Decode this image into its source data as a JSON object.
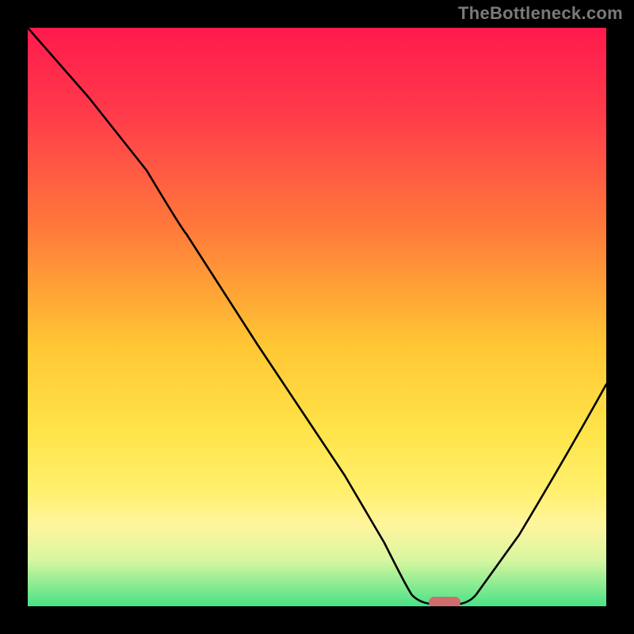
{
  "watermark": "TheBottleneck.com",
  "chart_data": {
    "type": "line",
    "title": "",
    "xlabel": "",
    "ylabel": "",
    "xlim": [
      0,
      100
    ],
    "ylim": [
      0,
      100
    ],
    "grid": false,
    "legend": false,
    "background_gradient": {
      "stops": [
        {
          "pos": 0,
          "color": "#ff1a4d"
        },
        {
          "pos": 15,
          "color": "#ff3b4a"
        },
        {
          "pos": 35,
          "color": "#ff7b3a"
        },
        {
          "pos": 55,
          "color": "#ffc733"
        },
        {
          "pos": 70,
          "color": "#ffe44a"
        },
        {
          "pos": 80,
          "color": "#fff06d"
        },
        {
          "pos": 86,
          "color": "#fff59e"
        },
        {
          "pos": 92,
          "color": "#d8f6a0"
        },
        {
          "pos": 100,
          "color": "#49e286"
        }
      ]
    },
    "series": [
      {
        "name": "bottleneck-curve",
        "x": [
          0,
          10,
          20,
          27,
          40,
          55,
          62,
          66,
          70,
          74,
          80,
          90,
          100
        ],
        "y": [
          100,
          88,
          75,
          65,
          45,
          23,
          10,
          3,
          0,
          0,
          10,
          30,
          50
        ]
      }
    ],
    "marker": {
      "name": "optimal-zone",
      "x": 72,
      "y": 0.5,
      "color": "#d06a6a"
    }
  }
}
